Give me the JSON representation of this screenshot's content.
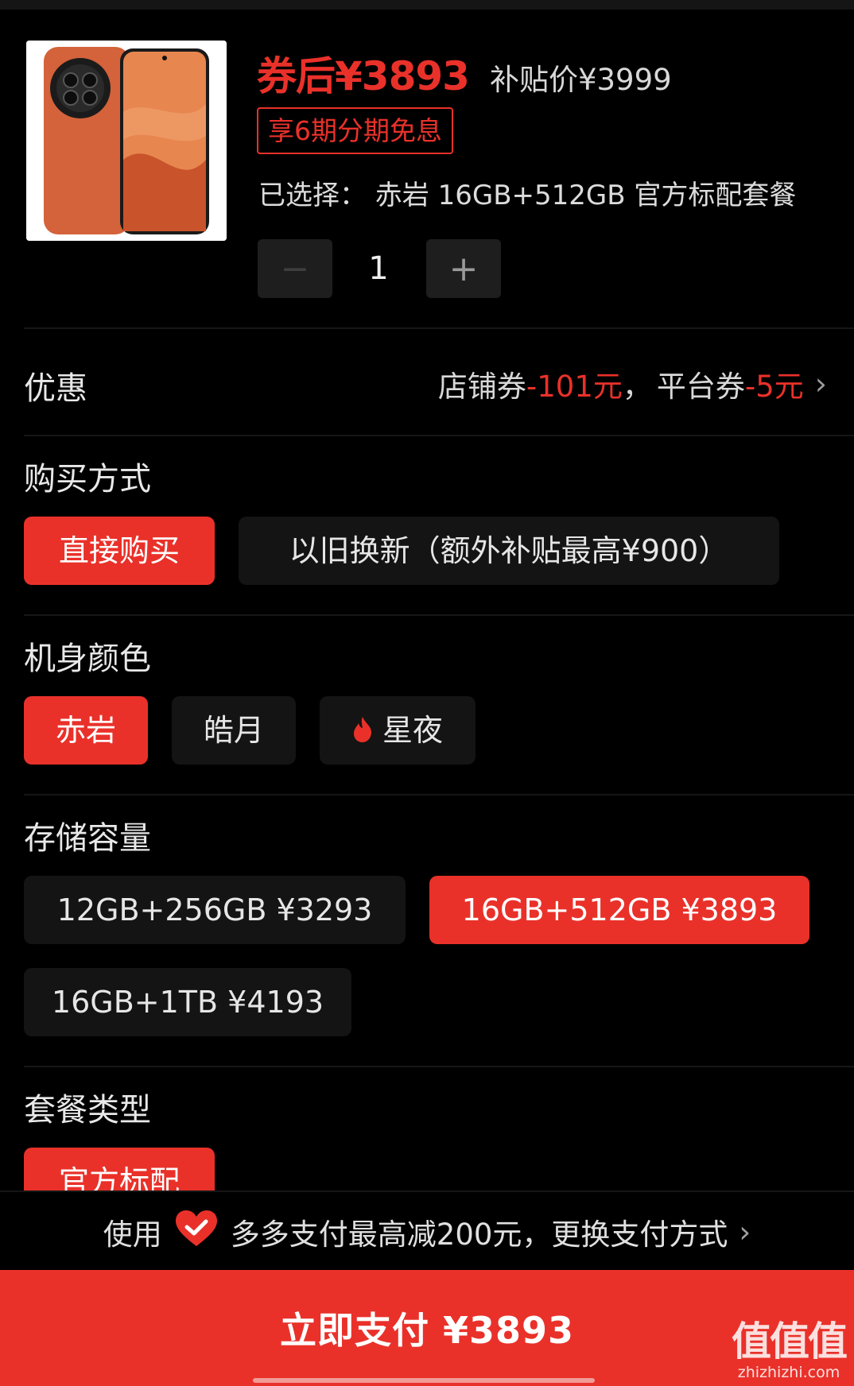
{
  "product": {
    "price_after_coupon": "券后¥3893",
    "subsidy_price": "补贴价¥3999",
    "installment_badge": "享6期分期免息",
    "selected_text": "已选择：  赤岩 16GB+512GB 官方标配套餐",
    "quantity": "1",
    "minus_label": "−",
    "plus_label": "+"
  },
  "coupon": {
    "title": "优惠",
    "store_label": "店铺券",
    "store_value": "-101元",
    "separator": "，",
    "platform_label": "平台券",
    "platform_value": "-5元",
    "chevron": "›"
  },
  "purchase_method": {
    "title": "购买方式",
    "options": [
      "直接购买",
      "以旧换新（额外补贴最高¥900）"
    ],
    "selected_index": 0
  },
  "color": {
    "title": "机身颜色",
    "options": [
      "赤岩",
      "皓月",
      "星夜"
    ],
    "selected_index": 0
  },
  "storage": {
    "title": "存储容量",
    "options": [
      "12GB+256GB ¥3293",
      "16GB+512GB ¥3893",
      "16GB+1TB ¥4193"
    ],
    "selected_index": 1
  },
  "package": {
    "title": "套餐类型",
    "options": [
      "官方标配"
    ],
    "selected_index": 0
  },
  "payment": {
    "prefix": "使用",
    "text": "多多支付最高减200元，更换支付方式",
    "arrow": "›",
    "button_label": "立即支付 ¥3893"
  },
  "watermark": {
    "logo_text": "值值值",
    "domain": "zhizhizhi.com"
  },
  "colors": {
    "accent": "#e9312a",
    "background": "#000000",
    "chip_bg": "#141414"
  }
}
